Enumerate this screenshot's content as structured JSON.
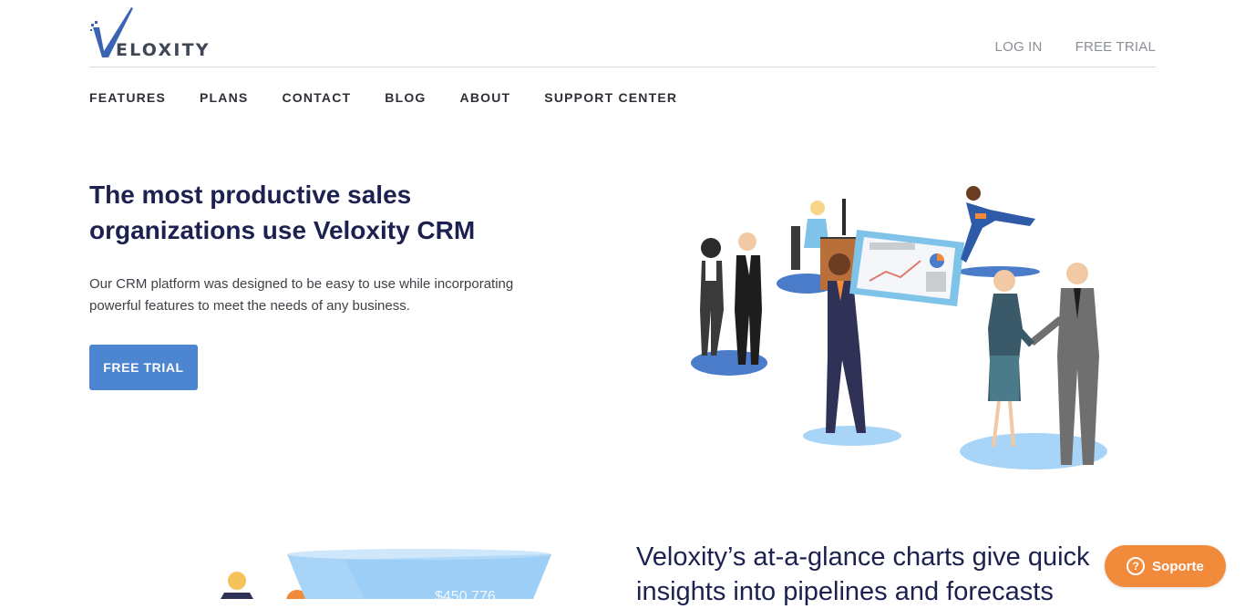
{
  "header": {
    "logo_text": "ELOXITY",
    "top_links": [
      "LOG IN",
      "FREE TRIAL"
    ]
  },
  "nav": {
    "items": [
      "FEATURES",
      "PLANS",
      "CONTACT",
      "BLOG",
      "ABOUT",
      "SUPPORT CENTER"
    ]
  },
  "hero": {
    "title": "The most productive sales organizations use Veloxity CRM",
    "description": "Our CRM platform was designed to be easy to use while incorporating powerful features to meet the needs of any business.",
    "cta_label": "FREE TRIAL"
  },
  "section": {
    "title": "Veloxity’s at-a-glance charts give quick insights into pipelines and forecasts",
    "funnel_value": "$450,776"
  },
  "support_widget": {
    "icon": "question-icon",
    "label": "Soporte"
  },
  "colors": {
    "brand_navy": "#1c2150",
    "primary_button": "#4d86d0",
    "support_orange": "#f28a3b",
    "illustration_blue": "#4a7cc9",
    "illustration_light_blue": "#a8d4f7"
  }
}
